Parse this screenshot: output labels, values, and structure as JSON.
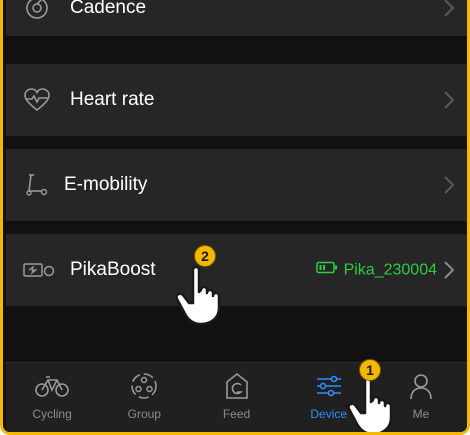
{
  "colors": {
    "accent_frame": "#f5b800",
    "active_tab": "#2f8cff",
    "battery_green": "#2ecc40",
    "row_bg": "#262626",
    "screen_bg": "#111111"
  },
  "device_list": {
    "items": [
      {
        "label": "Cadence",
        "icon": "cadence-icon"
      },
      {
        "label": "Heart rate",
        "icon": "heart-rate-icon"
      },
      {
        "label": "E-mobility",
        "icon": "scooter-icon"
      },
      {
        "label": "PikaBoost",
        "icon": "pikaboost-device-icon",
        "status_text": "Pika_230004",
        "status_icon": "battery-icon"
      }
    ]
  },
  "tabbar": {
    "tabs": [
      {
        "label": "Cycling",
        "icon": "bicycle-icon",
        "active": false
      },
      {
        "label": "Group",
        "icon": "group-icon",
        "active": false
      },
      {
        "label": "Feed",
        "icon": "feed-icon",
        "active": false
      },
      {
        "label": "Device",
        "icon": "device-icon",
        "active": true
      },
      {
        "label": "Me",
        "icon": "person-icon",
        "active": false
      }
    ]
  },
  "annotations": {
    "step_1": "1",
    "step_2": "2"
  }
}
